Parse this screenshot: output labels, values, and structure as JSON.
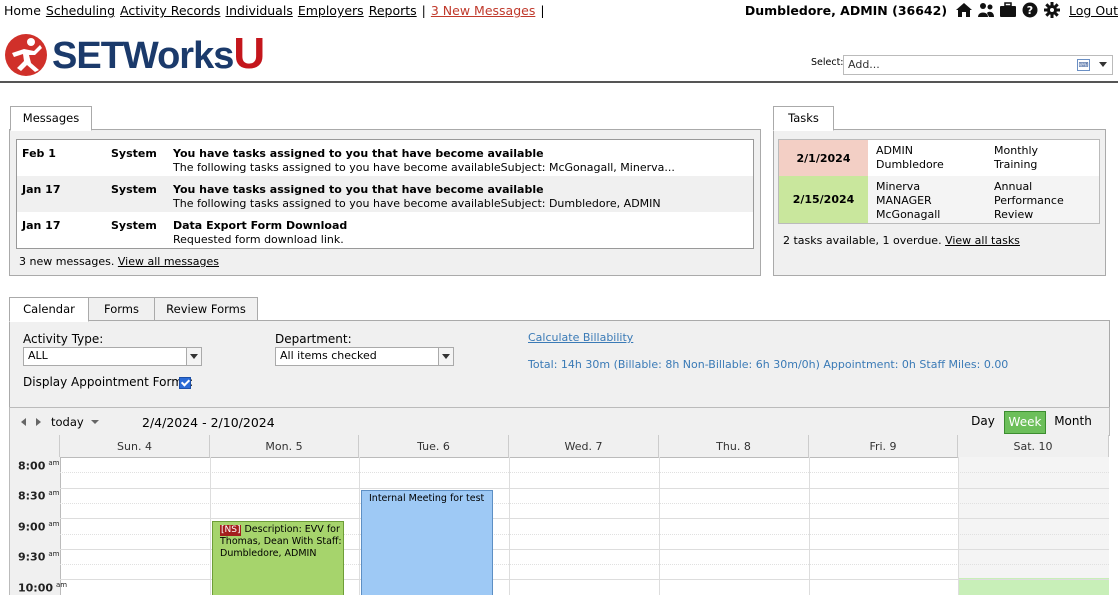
{
  "nav": {
    "items": [
      "Home",
      "Scheduling",
      "Activity Records",
      "Individuals",
      "Employers",
      "Reports"
    ],
    "messages_link": "3 New Messages",
    "user": "Dumbledore, ADMIN  (36642)",
    "logout": "Log Out"
  },
  "header": {
    "logo_text": "SETWorks",
    "logo_u": "U",
    "select_label": "Select:",
    "select_placeholder": "Add..."
  },
  "messages": {
    "tab": "Messages",
    "rows": [
      {
        "date": "Feb 1",
        "from": "System",
        "subject": "You have tasks assigned to you that have become available",
        "body": "The following tasks assigned to you have become availableSubject: McGonagall, Minerva..."
      },
      {
        "date": "Jan 17",
        "from": "System",
        "subject": "You have tasks assigned to you that have become available",
        "body": "The following tasks assigned to you have become availableSubject: Dumbledore, ADMIN"
      },
      {
        "date": "Jan 17",
        "from": "System",
        "subject": "Data Export Form Download",
        "body": "Requested form download link."
      }
    ],
    "footer_text": "3 new messages.",
    "footer_link": "View all messages"
  },
  "tasks": {
    "tab": "Tasks",
    "rows": [
      {
        "date": "2/1/2024",
        "who_1": "ADMIN",
        "who_2": "Dumbledore",
        "who_3": "",
        "what_1": "Monthly",
        "what_2": "Training",
        "what_3": "",
        "color": "#f3cfc5"
      },
      {
        "date": "2/15/2024",
        "who_1": "Minerva",
        "who_2": "MANAGER",
        "who_3": "McGonagall",
        "what_1": "Annual",
        "what_2": "Performance",
        "what_3": "Review",
        "color": "#c9e79d"
      }
    ],
    "footer_text": "2 tasks available, 1 overdue.",
    "footer_link": "View all tasks"
  },
  "calendar_tabs": [
    "Calendar",
    "Forms",
    "Review Forms"
  ],
  "filters": {
    "activity_type_label": "Activity Type:",
    "activity_type_value": "ALL",
    "department_label": "Department:",
    "department_value": "All items checked",
    "display_forms_label": "Display Appointment Forms:",
    "display_forms_checked": true,
    "calc_link": "Calculate Billability",
    "totals": "Total: 14h 30m   (Billable: 8h  Non-Billable: 6h 30m/0h)  Appointment: 0h  Staff Miles: 0.00"
  },
  "calendar": {
    "today_label": "today",
    "range": "2/4/2024 - 2/10/2024",
    "views": [
      "Day",
      "Week",
      "Month"
    ],
    "active_view": "Week",
    "days": [
      "Sun. 4",
      "Mon. 5",
      "Tue. 6",
      "Wed. 7",
      "Thu. 8",
      "Fri. 9",
      "Sat. 10"
    ],
    "times": [
      {
        "hour": "8:00",
        "ampm": "am"
      },
      {
        "hour": "8:30",
        "ampm": "am"
      },
      {
        "hour": "9:00",
        "ampm": "am"
      },
      {
        "hour": "9:30",
        "ampm": "am"
      },
      {
        "hour": "10:00",
        "ampm": "am"
      }
    ],
    "events": [
      {
        "tag": "[NS]",
        "text": "Description: EVV for Thomas, Dean With Staff: Dumbledore, ADMIN",
        "color": "#a6d46c"
      },
      {
        "tag": "",
        "text": "Internal Meeting for test",
        "color": "#9ec9f5"
      }
    ]
  }
}
